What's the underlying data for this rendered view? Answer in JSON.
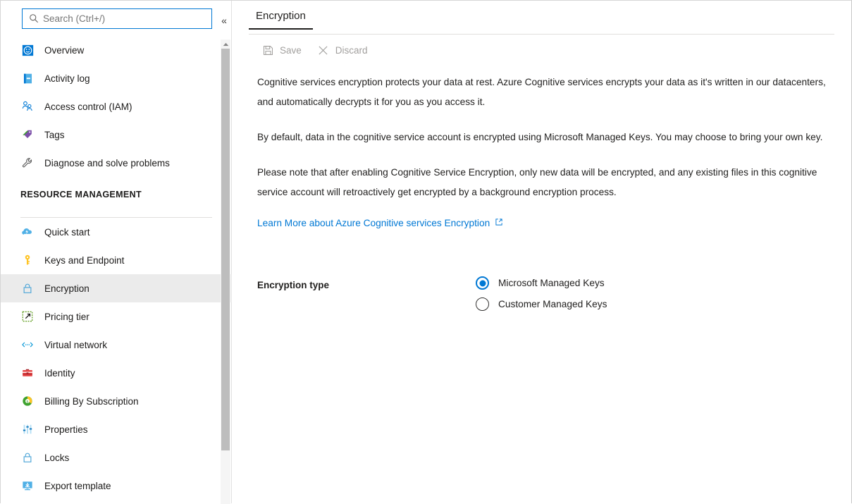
{
  "sidebar": {
    "search": {
      "placeholder": "Search (Ctrl+/)",
      "value": "",
      "icon": "search-icon"
    },
    "collapse_label": "«",
    "items": [
      {
        "label": "Overview",
        "icon": "overview-icon",
        "selected": false
      },
      {
        "label": "Activity log",
        "icon": "activity-log-icon",
        "selected": false
      },
      {
        "label": "Access control (IAM)",
        "icon": "access-control-icon",
        "selected": false
      },
      {
        "label": "Tags",
        "icon": "tags-icon",
        "selected": false
      },
      {
        "label": "Diagnose and solve problems",
        "icon": "wrench-icon",
        "selected": false
      }
    ],
    "section": {
      "title": "Resource management"
    },
    "section_items": [
      {
        "label": "Quick start",
        "icon": "quick-start-icon",
        "selected": false
      },
      {
        "label": "Keys and Endpoint",
        "icon": "key-icon",
        "selected": false
      },
      {
        "label": "Encryption",
        "icon": "lock-icon",
        "selected": true
      },
      {
        "label": "Pricing tier",
        "icon": "pricing-tier-icon",
        "selected": false
      },
      {
        "label": "Virtual network",
        "icon": "virtual-network-icon",
        "selected": false
      },
      {
        "label": "Identity",
        "icon": "identity-icon",
        "selected": false
      },
      {
        "label": "Billing By Subscription",
        "icon": "billing-icon",
        "selected": false
      },
      {
        "label": "Properties",
        "icon": "properties-icon",
        "selected": false
      },
      {
        "label": "Locks",
        "icon": "locks-icon",
        "selected": false
      },
      {
        "label": "Export template",
        "icon": "export-template-icon",
        "selected": false
      }
    ]
  },
  "main": {
    "tab": {
      "label": "Encryption"
    },
    "toolbar": {
      "save_label": "Save",
      "save_icon": "save-icon",
      "discard_label": "Discard",
      "discard_icon": "discard-icon"
    },
    "paragraphs": [
      "Cognitive services encryption protects your data at rest. Azure Cognitive services encrypts your data as it's written in our datacenters, and automatically decrypts it for you as you access it.",
      "By default, data in the cognitive service account is encrypted using Microsoft Managed Keys. You may choose to bring your own key.",
      "Please note that after enabling Cognitive Service Encryption, only new data will be encrypted, and any existing files in this cognitive service account will retroactively get encrypted by a background encryption process."
    ],
    "link": {
      "label": "Learn More about Azure Cognitive services Encryption",
      "icon": "external-link-icon"
    },
    "form": {
      "encryption_type_label": "Encryption type",
      "options": [
        {
          "label": "Microsoft Managed Keys",
          "checked": true
        },
        {
          "label": "Customer Managed Keys",
          "checked": false
        }
      ]
    }
  },
  "colors": {
    "accent": "#0078d4",
    "selected_row": "#ebebeb",
    "text": "#201f1e",
    "disabled_text": "#a19f9d"
  }
}
